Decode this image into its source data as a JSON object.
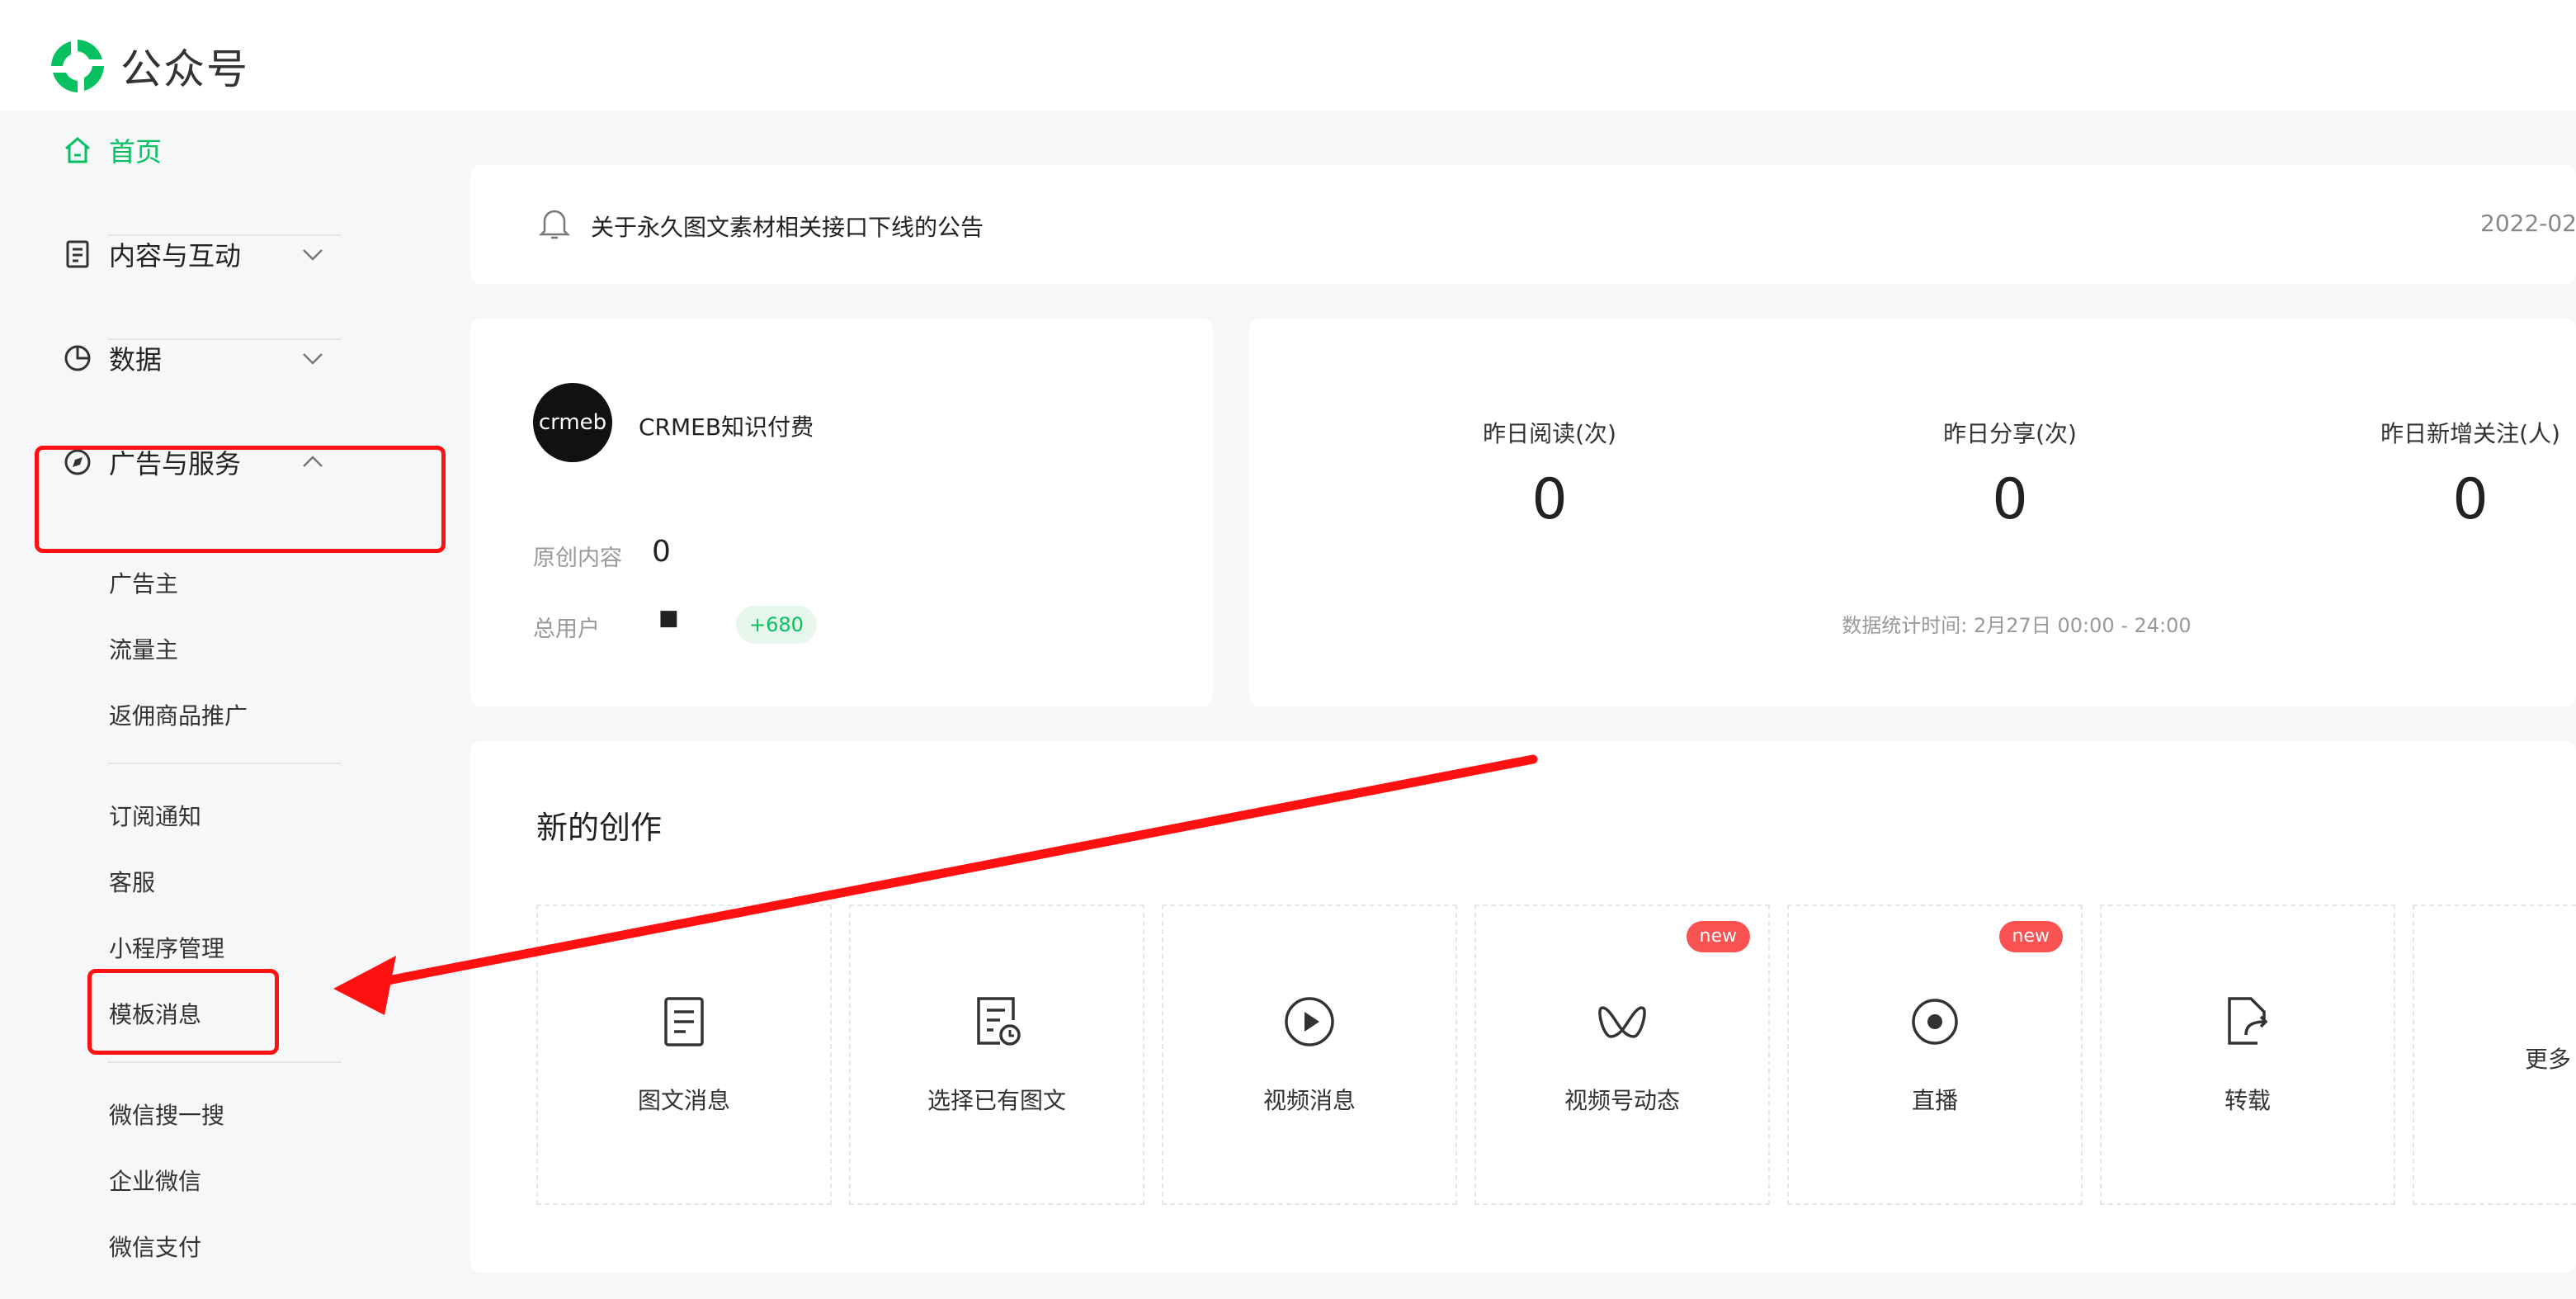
{
  "header": {
    "title": "公众号"
  },
  "sidebar": {
    "home": "首页",
    "content": "内容与互动",
    "data": "数据",
    "ads": "广告与服务",
    "ads_items": [
      "广告主",
      "流量主",
      "返佣商品推广"
    ],
    "service_items": [
      "订阅通知",
      "客服",
      "小程序管理",
      "模板消息"
    ],
    "other_items": [
      "微信搜一搜",
      "企业微信",
      "微信支付"
    ]
  },
  "notice": {
    "text": "关于永久图文素材相关接口下线的公告",
    "date": "2022-02"
  },
  "account": {
    "name": "CRMEB知识付费",
    "avatar_text": "crmeb",
    "original_label": "原创内容",
    "original_value": "0",
    "users_label": "总用户",
    "users_value": "■",
    "users_delta": "+680"
  },
  "stats": {
    "items": [
      {
        "label": "昨日阅读(次)",
        "value": "0"
      },
      {
        "label": "昨日分享(次)",
        "value": "0"
      },
      {
        "label": "昨日新增关注(人)",
        "value": "0"
      }
    ],
    "time": "数据统计时间: 2月27日 00:00 - 24:00"
  },
  "create": {
    "title": "新的创作",
    "tiles": [
      {
        "label": "图文消息",
        "icon": "article-icon"
      },
      {
        "label": "选择已有图文",
        "icon": "article-history-icon"
      },
      {
        "label": "视频消息",
        "icon": "play-icon",
        "badge": ""
      },
      {
        "label": "视频号动态",
        "icon": "channels-icon",
        "badge": "new"
      },
      {
        "label": "直播",
        "icon": "live-icon",
        "badge": "new"
      },
      {
        "label": "转载",
        "icon": "repost-icon"
      },
      {
        "label": "更多",
        "icon": ""
      }
    ]
  },
  "colors": {
    "accent": "#07c160",
    "annotation": "#ff1111",
    "badge": "#fa5151"
  }
}
